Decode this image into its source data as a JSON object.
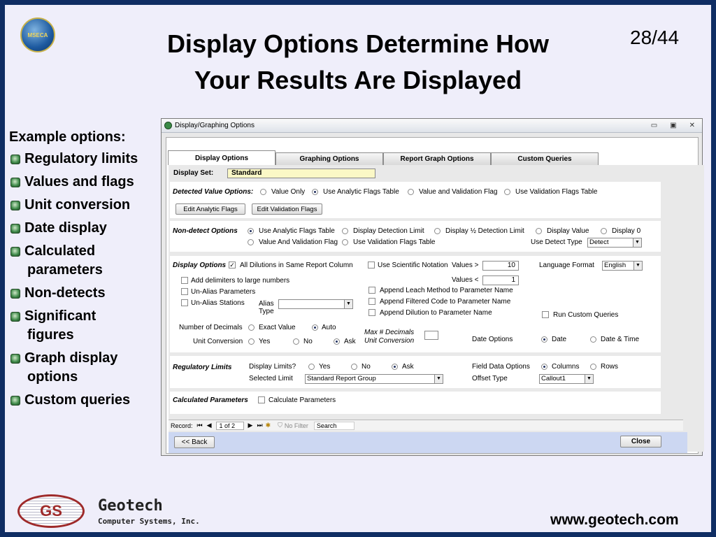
{
  "slide": {
    "title_line1": "Display Options Determine How",
    "title_line2": "Your Results Are Displayed",
    "page_number": "28/44",
    "seal_text": "MSECA",
    "bullets_heading": "Example options:",
    "bullets": [
      [
        "Regulatory limits"
      ],
      [
        "Values and flags"
      ],
      [
        "Unit conversion"
      ],
      [
        "Date display"
      ],
      [
        "Calculated",
        "parameters"
      ],
      [
        "Non-detects"
      ],
      [
        "Significant",
        "figures"
      ],
      [
        "Graph display",
        "options"
      ],
      [
        "Custom queries"
      ]
    ],
    "company_name": "Geotech",
    "company_sub": "Computer Systems, Inc.",
    "url": "www.geotech.com"
  },
  "window": {
    "title": "Display/Graphing Options",
    "controls": [
      "▭",
      "▣",
      "✕"
    ],
    "tabs": [
      "Display Options",
      "Graphing Options",
      "Report Graph Options",
      "Custom Queries"
    ],
    "display_set_label": "Display Set:",
    "display_set_value": "Standard",
    "detected": {
      "label": "Detected Value Options:",
      "options": [
        "Value Only",
        "Use Analytic Flags Table",
        "Value and Validation Flag",
        "Use Validation Flags Table"
      ],
      "selected": 1,
      "edit_analytic": "Edit Analytic Flags",
      "edit_validation": "Edit Validation Flags"
    },
    "nondetect": {
      "label": "Non-detect Options",
      "options": [
        "Use Analytic Flags Table",
        "Display Detection Limit",
        "Display ½ Detection Limit",
        "Display Value",
        "Display 0",
        "Value And Validation Flag",
        "Use Validation Flags Table"
      ],
      "selected": 0,
      "use_detect_type_label": "Use Detect Type",
      "use_detect_type_value": "Detect"
    },
    "display_options": {
      "label": "Display Options",
      "all_dilutions": "All Dilutions in Same Report Column",
      "scientific": "Use Scientific Notation",
      "values_gt_label": "Values >",
      "values_gt": "10",
      "values_lt_label": "Values <",
      "values_lt": "1",
      "language_label": "Language Format",
      "language_value": "English",
      "add_delimiters": "Add delimiters to large numbers",
      "unalias_params": "Un-Alias Parameters",
      "unalias_stations": "Un-Alias Stations",
      "alias_type": "Alias Type",
      "append_leach": "Append Leach Method to  Parameter Name",
      "append_filtered": "Append Filtered Code to  Parameter Name",
      "append_dilution": "Append Dilution to  Parameter Name",
      "run_custom": "Run Custom Queries",
      "decimals_label": "Number of Decimals",
      "exact_value": "Exact Value",
      "auto": "Auto",
      "max_decimals": "Max # Decimals Unit Conversion",
      "unit_conv_label": "Unit Conversion",
      "yes": "Yes",
      "no": "No",
      "ask": "Ask",
      "date_options_label": "Date Options",
      "date": "Date",
      "date_time": "Date & Time"
    },
    "regulatory": {
      "label": "Regulatory Limits",
      "display_limits": "Display Limits?",
      "yes": "Yes",
      "no": "No",
      "ask": "Ask",
      "selected_limit_label": "Selected Limit",
      "selected_limit_value": "Standard Report Group",
      "field_data_label": "Field Data Options",
      "columns": "Columns",
      "rows": "Rows",
      "offset_label": "Offset Type",
      "offset_value": "Callout1"
    },
    "calculated": {
      "label": "Calculated Parameters",
      "checkbox": "Calculate Parameters"
    },
    "record_nav": {
      "record_label": "Record:",
      "position": "1 of 2",
      "no_filter": "No Filter",
      "search": "Search"
    },
    "back_button": "<< Back",
    "close_button": "Close"
  }
}
